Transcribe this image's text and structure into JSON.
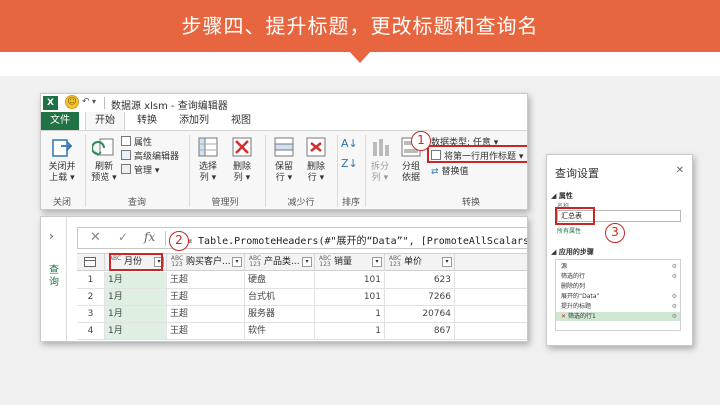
{
  "slide": {
    "title": "步骤四、提升标题，更改标题和查询名",
    "accent_color": "#e8663f"
  },
  "title_bar": {
    "app_icon": "X",
    "title": "数据源 xlsm - 查询编辑器"
  },
  "tabs": {
    "file": "文件",
    "items": [
      "开始",
      "转换",
      "添加列",
      "视图"
    ]
  },
  "ribbon": {
    "groups": {
      "close": "关闭",
      "query": "查询",
      "manage_cols": "管理列",
      "reduce_rows": "减少行",
      "sort": "排序",
      "transform": "转换"
    },
    "close_load": [
      "关闭并",
      "上载"
    ],
    "refresh_preview": [
      "刷新",
      "预览"
    ],
    "properties": "属性",
    "advanced_editor": "高级编辑器",
    "manage": "管理",
    "choose_cols": [
      "选择",
      "列"
    ],
    "remove_cols": [
      "删除",
      "列"
    ],
    "keep_rows": [
      "保留",
      "行"
    ],
    "remove_rows": [
      "删除",
      "行"
    ],
    "split_col": [
      "拆分",
      "列"
    ],
    "group_by": [
      "分组",
      "依据"
    ],
    "data_type": "数据类型: 任意",
    "use_first_row": "将第一行用作标题",
    "replace_values": "替换值"
  },
  "annotations": {
    "step1": "1",
    "step2": "2",
    "step3": "3",
    "highlight_color": "#c62828"
  },
  "grid": {
    "side_label": "查询",
    "formula": "= Table.PromoteHeaders(#\"展开的“Data”\", [PromoteAllScalars=true])",
    "columns": [
      {
        "type": "ABC",
        "name": "月份"
      },
      {
        "type": "ABC\n123",
        "name": "购买客户..."
      },
      {
        "type": "ABC\n123",
        "name": "产品类..."
      },
      {
        "type": "ABC\n123",
        "name": "销量"
      },
      {
        "type": "ABC\n123",
        "name": "单价"
      }
    ],
    "rows": [
      {
        "n": "1",
        "c": [
          "1月",
          "王超",
          "硬盘",
          "101",
          "623"
        ]
      },
      {
        "n": "2",
        "c": [
          "1月",
          "王超",
          "台式机",
          "101",
          "7266"
        ]
      },
      {
        "n": "3",
        "c": [
          "1月",
          "王超",
          "服务器",
          "1",
          "20764"
        ]
      },
      {
        "n": "4",
        "c": [
          "1月",
          "王超",
          "软件",
          "1",
          "867"
        ]
      }
    ]
  },
  "query_settings": {
    "title": "查询设置",
    "properties_label": "属性",
    "name_label": "名称",
    "name_value": "汇总表",
    "all_properties": "所有属性",
    "applied_steps_label": "应用的步骤",
    "steps": [
      "源",
      "筛选的行",
      "删除的列",
      "展开的“Data”",
      "提升的标题",
      "筛选的行1"
    ]
  }
}
